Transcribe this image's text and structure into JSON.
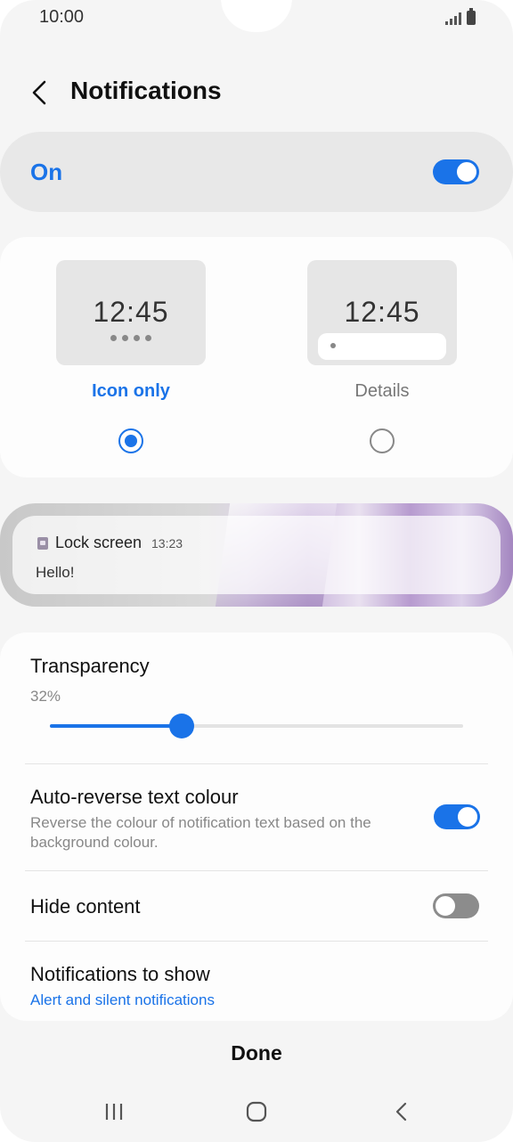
{
  "status_bar": {
    "time": "10:00",
    "icons": [
      "signal-icon",
      "battery-icon"
    ]
  },
  "header": {
    "back_icon": "chevron-left-icon",
    "title": "Notifications"
  },
  "master_switch": {
    "label": "On",
    "state": "on"
  },
  "style_options": {
    "selected": "Icon only",
    "options": [
      {
        "label": "Icon only",
        "preview_time": "12:45",
        "selected": true
      },
      {
        "label": "Details",
        "preview_time": "12:45",
        "selected": false
      }
    ]
  },
  "preview_notification": {
    "app_icon": "lock-icon",
    "app_name": "Lock screen",
    "time": "13:23",
    "message": "Hello!"
  },
  "settings": {
    "transparency": {
      "title": "Transparency",
      "value_text": "32%",
      "value": 32
    },
    "auto_reverse": {
      "title": "Auto-reverse text colour",
      "subtitle": "Reverse the colour of notification text based on the background colour.",
      "state": "on"
    },
    "hide_content": {
      "title": "Hide content",
      "state": "off"
    },
    "notifications_to_show": {
      "title": "Notifications to show",
      "value": "Alert and silent notifications"
    }
  },
  "footer": {
    "done_label": "Done"
  },
  "nav_bar": {
    "icons": [
      "recent-apps-icon",
      "home-icon",
      "back-icon"
    ]
  },
  "colors": {
    "accent": "#1a73e8",
    "background": "#f5f5f5",
    "card": "#fdfdfd"
  }
}
